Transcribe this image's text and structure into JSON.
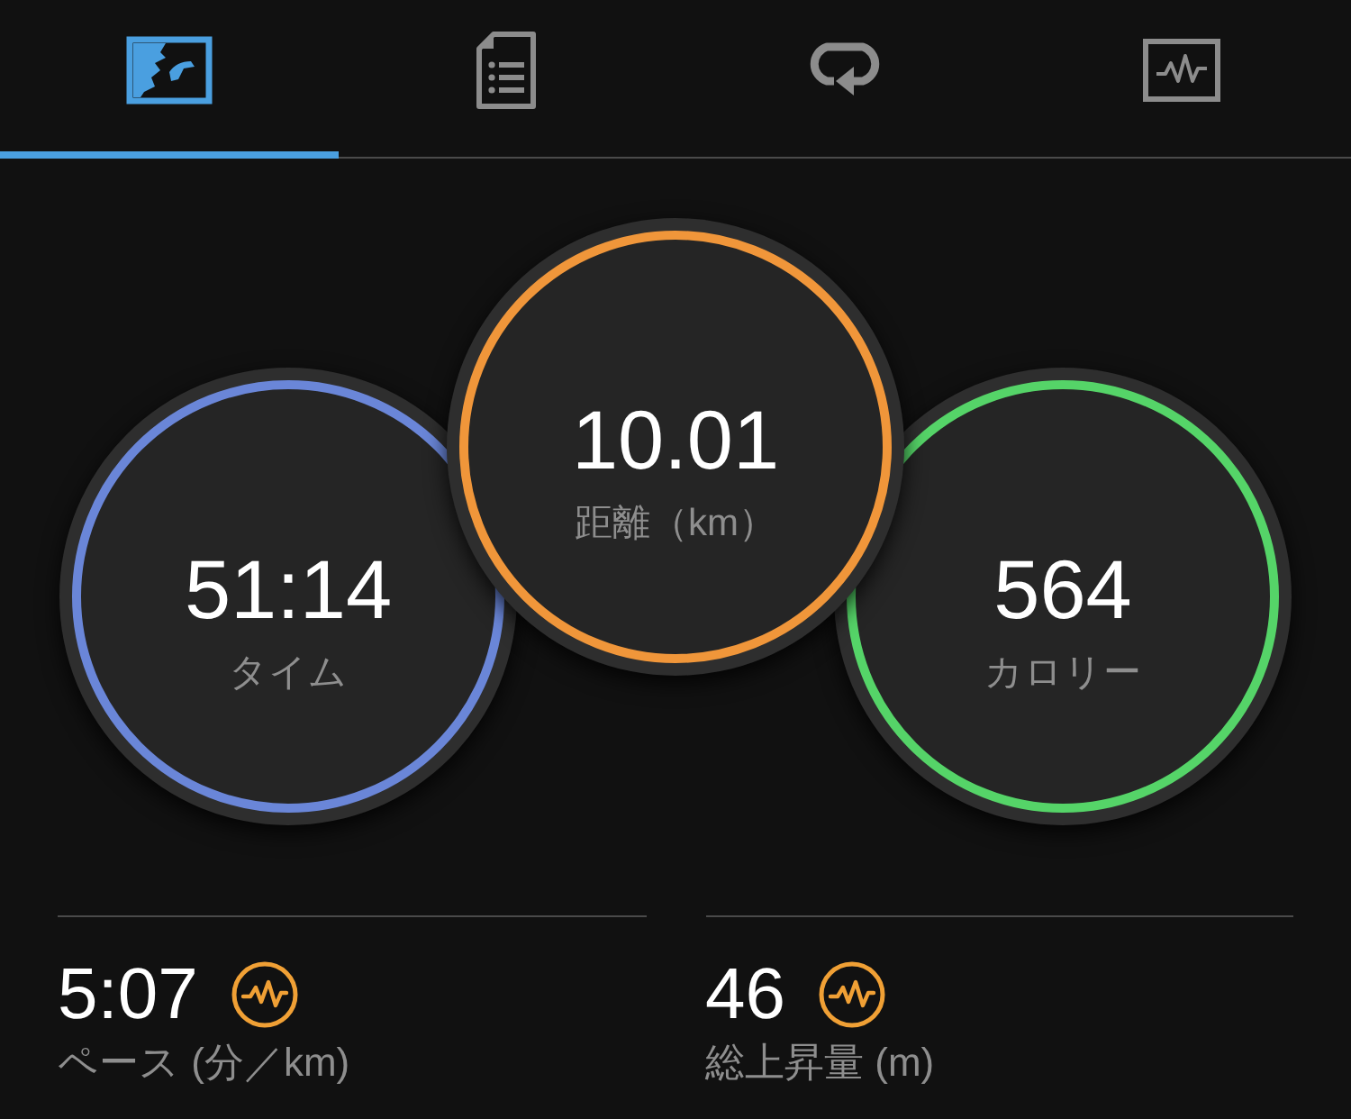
{
  "tabs": [
    {
      "selected": true
    },
    {
      "selected": false
    },
    {
      "selected": false
    },
    {
      "selected": false
    }
  ],
  "circles": [
    {
      "value": "51:14",
      "label": "タイム",
      "color": "#6a86d8"
    },
    {
      "value": "10.01",
      "label": "距離（km）",
      "color": "#f0963a"
    },
    {
      "value": "564",
      "label": "カロリー",
      "color": "#55d468"
    }
  ],
  "stats": [
    {
      "value": "5:07",
      "label": "ペース (分／km)"
    },
    {
      "value": "46",
      "label": "総上昇量 (m)"
    }
  ]
}
